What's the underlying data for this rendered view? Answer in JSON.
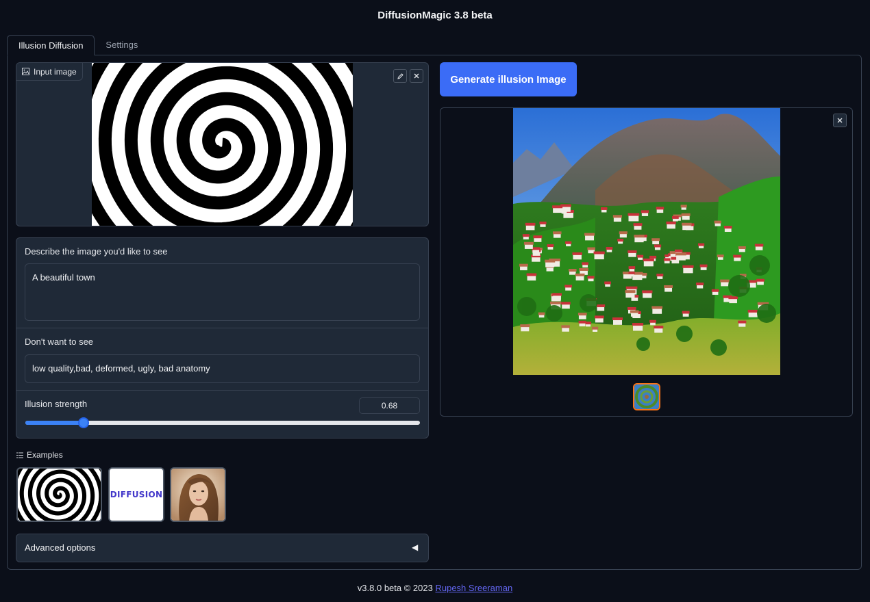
{
  "app": {
    "title": "DiffusionMagic 3.8 beta"
  },
  "tabs": [
    {
      "label": "Illusion Diffusion",
      "active": true
    },
    {
      "label": "Settings",
      "active": false
    }
  ],
  "input_image": {
    "label": "Input image",
    "edit_icon": "pencil-icon",
    "clear_icon": "close-icon"
  },
  "prompt": {
    "label": "Describe the image you'd like to see",
    "value": "A beautiful town"
  },
  "negative_prompt": {
    "label": "Don't want to see",
    "value": "low quality,bad, deformed, ugly, bad anatomy"
  },
  "illusion_strength": {
    "label": "Illusion strength",
    "value": "0.68",
    "fraction": 0.147
  },
  "examples": {
    "label": "Examples",
    "items": [
      {
        "name": "spiral",
        "text": ""
      },
      {
        "name": "diffusion-text",
        "text": "DIFFUSION"
      },
      {
        "name": "portrait",
        "text": ""
      }
    ]
  },
  "advanced": {
    "label": "Advanced options",
    "arrow": "◀"
  },
  "generate": {
    "label": "Generate illusion Image"
  },
  "output": {
    "clear_icon": "close-icon"
  },
  "footer": {
    "text": "v3.8.0 beta © 2023 ",
    "link": "Rupesh Sreeraman"
  },
  "colors": {
    "accent": "#3b6cf6",
    "background": "#0b0f19",
    "panel": "#1f2937",
    "selected_thumb": "#f97316"
  }
}
